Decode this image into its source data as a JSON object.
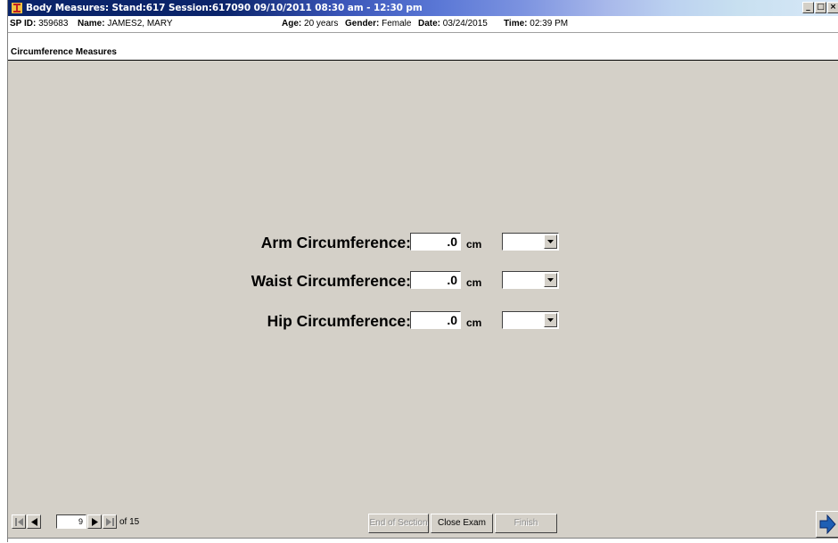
{
  "window": {
    "title": "Body Measures: Stand:617 Session:617090 09/10/2011 08:30 am - 12:30 pm",
    "controls": [
      "_",
      "□",
      "×"
    ]
  },
  "info": {
    "sp_id_label": "SP ID:",
    "sp_id": "359683",
    "name_label": "Name:",
    "name": "JAMES2, MARY",
    "age_label": "Age:",
    "age": "20 years",
    "gender_label": "Gender:",
    "gender": "Female",
    "date_label": "Date:",
    "date": "03/24/2015",
    "time_label": "Time:",
    "time": "02:39 PM"
  },
  "section": {
    "title": "Circumference Measures"
  },
  "measures": [
    {
      "label": "Arm Circumference:",
      "value": ".0",
      "unit": "cm",
      "select": ""
    },
    {
      "label": "Waist Circumference:",
      "value": ".0",
      "unit": "cm",
      "select": ""
    },
    {
      "label": "Hip Circumference:",
      "value": ".0",
      "unit": "cm",
      "select": ""
    }
  ],
  "nav": {
    "page": "9",
    "of_text": "of 15",
    "end_of_section": "End of Section",
    "close_exam": "Close Exam",
    "finish": "Finish"
  },
  "colors": {
    "title_bar_start": "#0a246a",
    "window_bg": "#d4d0c8"
  }
}
